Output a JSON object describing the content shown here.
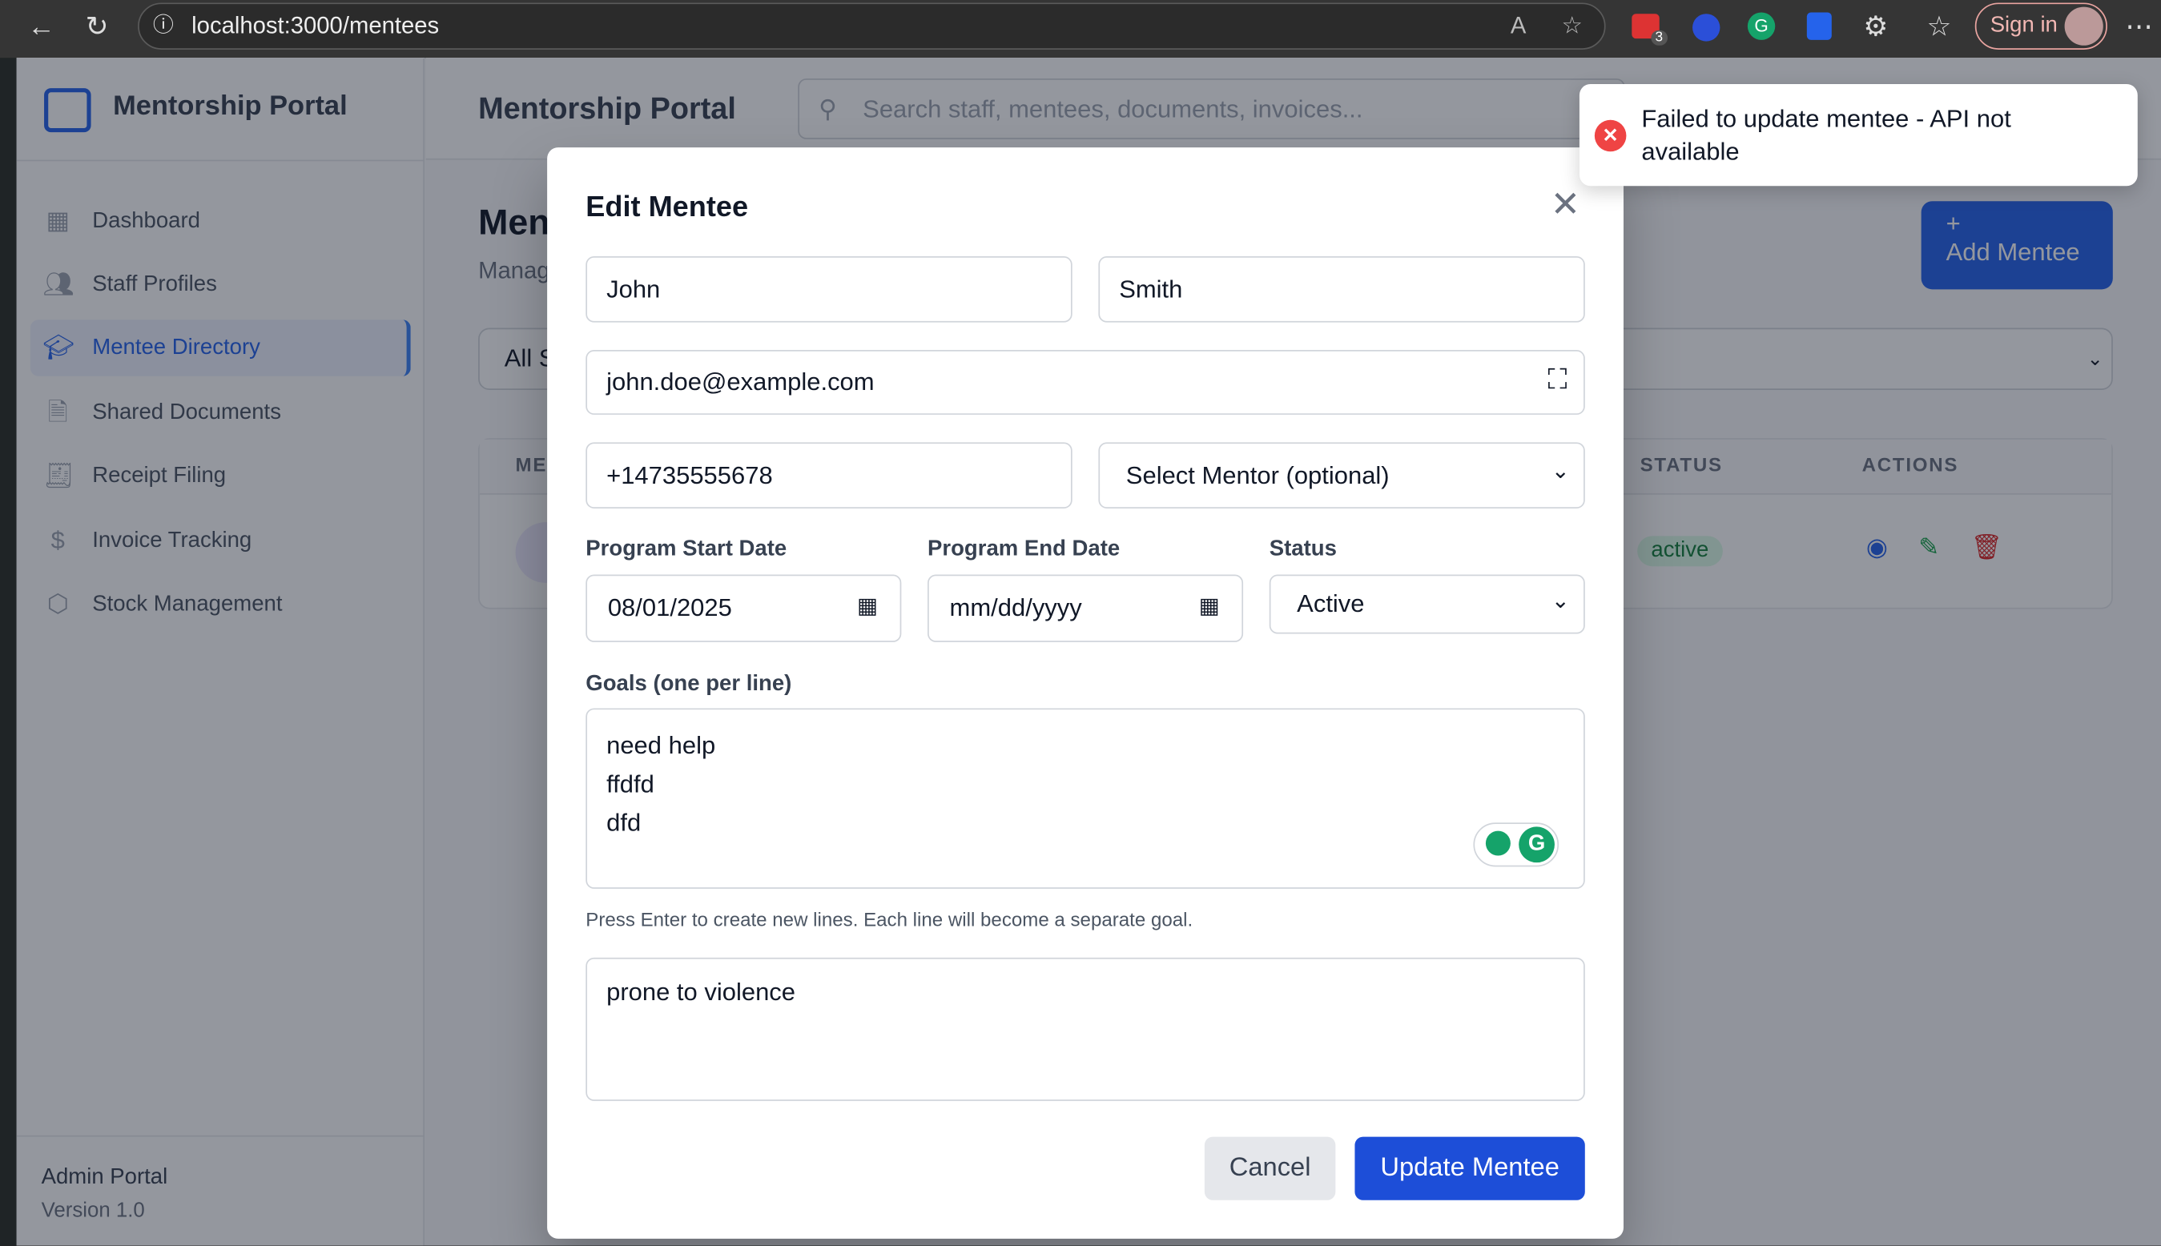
{
  "browser": {
    "url": "localhost:3000/mentees",
    "sign_in": "Sign in",
    "ext_badge": "3"
  },
  "sidebar": {
    "brand": "Mentorship Portal",
    "items": [
      {
        "label": "Dashboard",
        "icon": "dashboard-icon"
      },
      {
        "label": "Staff Profiles",
        "icon": "users-icon"
      },
      {
        "label": "Mentee Directory",
        "icon": "graduation-cap-icon",
        "active": true
      },
      {
        "label": "Shared Documents",
        "icon": "document-icon"
      },
      {
        "label": "Receipt Filing",
        "icon": "receipt-icon"
      },
      {
        "label": "Invoice Tracking",
        "icon": "dollar-icon"
      },
      {
        "label": "Stock Management",
        "icon": "box-icon"
      }
    ],
    "footer_title": "Admin Portal",
    "footer_version": "Version 1.0"
  },
  "header": {
    "title": "Mentorship Portal",
    "search_placeholder": "Search staff, mentees, documents, invoices..."
  },
  "page": {
    "title": "Mentee Directory",
    "subtitle": "Manage",
    "add_button": "Add Mentee",
    "filter": "All Status",
    "table": {
      "headers": [
        "MENTEE",
        "STATUS",
        "ACTIONS"
      ],
      "rows": [
        {
          "status": "active"
        }
      ]
    }
  },
  "modal": {
    "title": "Edit Mentee",
    "first_name": "John",
    "last_name": "Smith",
    "email": "john.doe@example.com",
    "phone": "+14735555678",
    "mentor_select": "Select Mentor (optional)",
    "start_label": "Program Start Date",
    "start_value": "08/01/2025",
    "end_label": "Program End Date",
    "end_placeholder": "mm/dd/yyyy",
    "status_label": "Status",
    "status_value": "Active",
    "goals_label": "Goals (one per line)",
    "goals": "need help\nffdfd\ndfd",
    "goals_help": "Press Enter to create new lines. Each line will become a separate goal.",
    "notes": "prone to violence",
    "cancel": "Cancel",
    "submit": "Update Mentee"
  },
  "toast": {
    "message": "Failed to update mentee - API not available",
    "type": "error",
    "color": "#ef4444"
  },
  "colors": {
    "primary": "#1d4ed8",
    "active_nav": "#2563eb"
  }
}
